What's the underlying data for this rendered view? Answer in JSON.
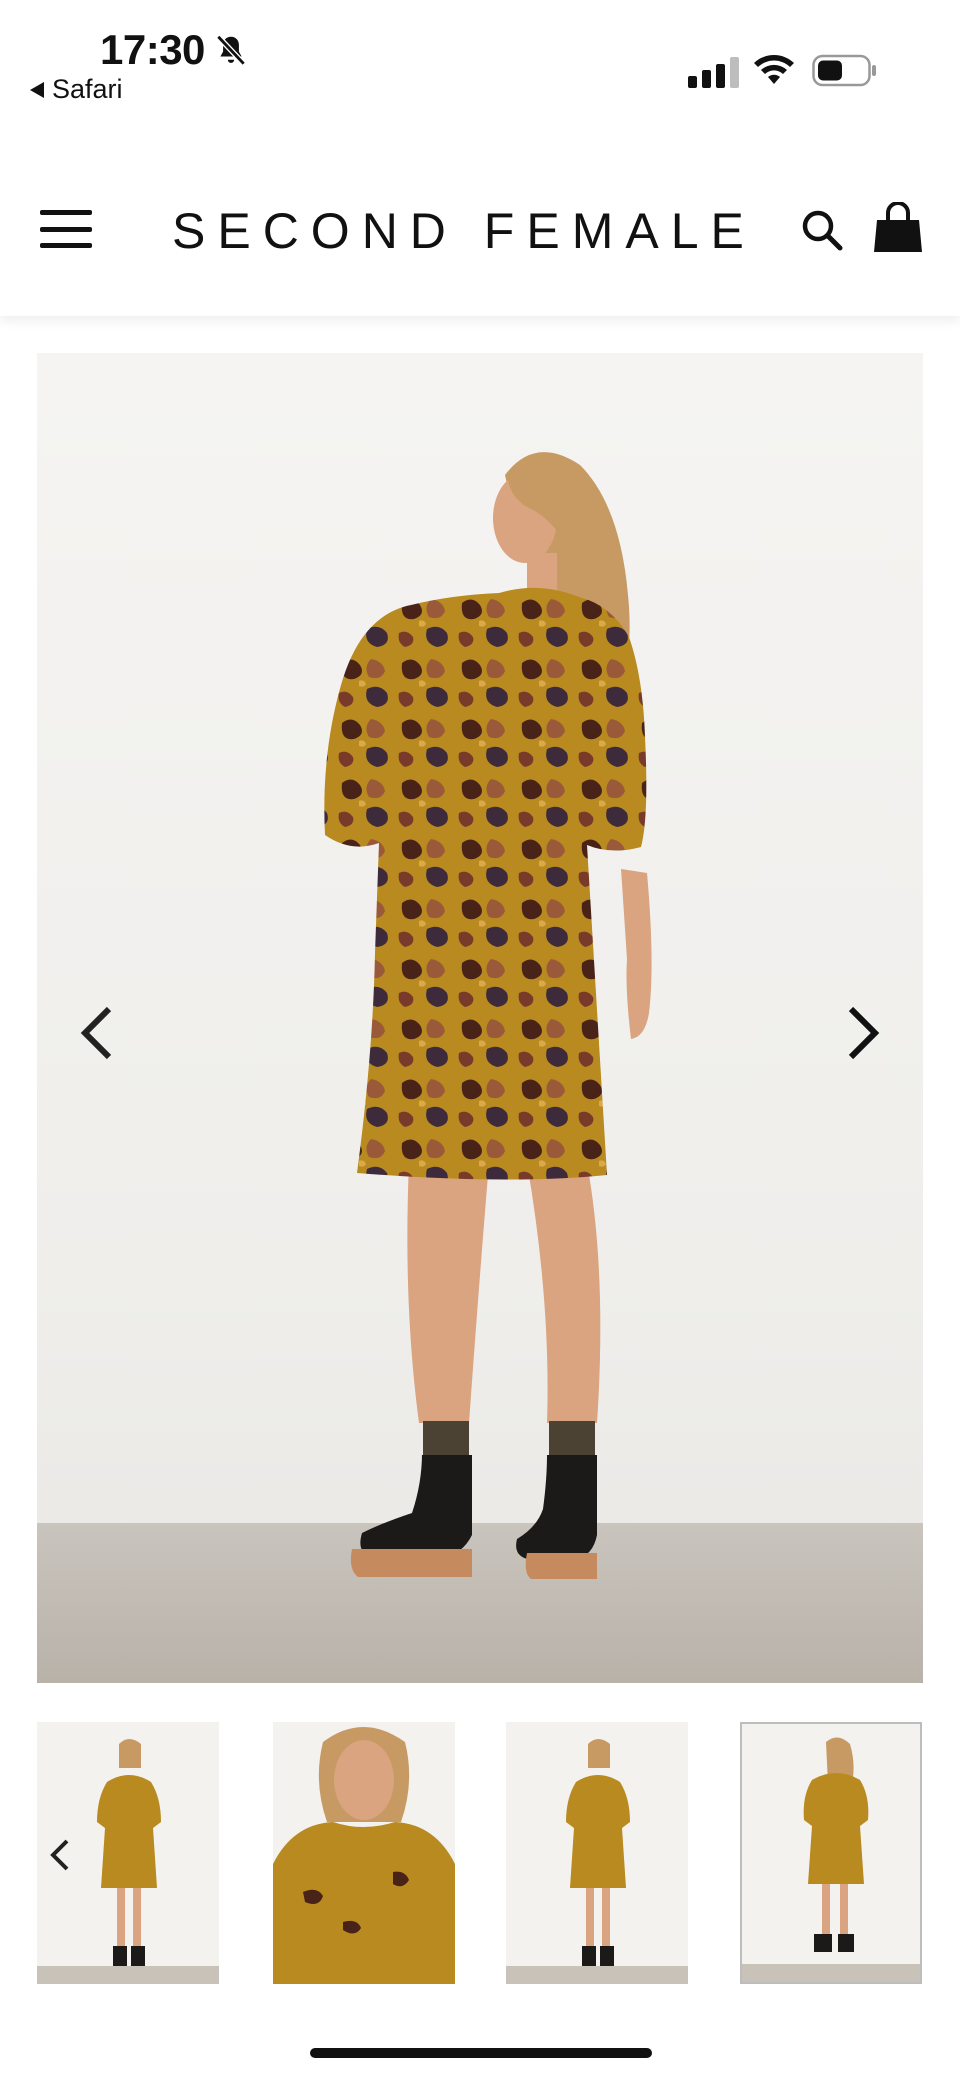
{
  "status_bar": {
    "time": "17:30",
    "back_app": "Safari",
    "icons": [
      "bell-slash-icon",
      "cellular-signal-icon",
      "wifi-icon",
      "battery-icon"
    ]
  },
  "header": {
    "logo": "SECOND FEMALE",
    "icons": [
      "menu-icon",
      "search-icon",
      "shopping-bag-icon"
    ]
  },
  "gallery": {
    "main_image": "product-photo-back-view",
    "prev_icon": "chevron-left-icon",
    "next_icon": "chevron-right-icon",
    "thumbnails": [
      {
        "name": "thumbnail-front-full",
        "active": false
      },
      {
        "name": "thumbnail-front-closeup",
        "active": false
      },
      {
        "name": "thumbnail-front-full-2",
        "active": false
      },
      {
        "name": "thumbnail-back-full",
        "active": true
      }
    ]
  },
  "colors": {
    "dress_gold": "#b88a1f",
    "dress_dark": "#4a2318",
    "dress_copper": "#9a5a3a",
    "skin": "#d9a47f",
    "hair": "#c79a63",
    "boot": "#1b1a19",
    "sole": "#c68a5f"
  }
}
